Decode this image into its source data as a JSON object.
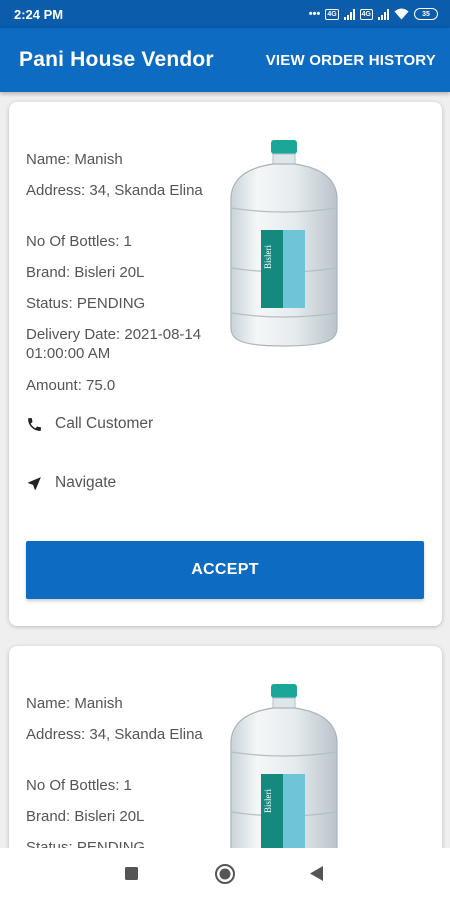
{
  "status_bar": {
    "time": "2:24 PM",
    "battery": "35"
  },
  "app_bar": {
    "title": "Pani House Vendor",
    "history_label": "VIEW ORDER HISTORY"
  },
  "orders": [
    {
      "name": "Name: Manish",
      "address": "Address: 34, Skanda Elina",
      "bottles": "No Of Bottles: 1",
      "brand": "Brand: Bisleri 20L",
      "status": "Status: PENDING",
      "delivery_date": "Delivery Date: 2021-08-14 01:00:00 AM",
      "amount": "Amount: 75.0",
      "call_label": "Call Customer",
      "navigate_label": "Navigate",
      "accept_label": "ACCEPT",
      "bottle_label": "Bisleri"
    },
    {
      "name": "Name: Manish",
      "address": "Address: 34, Skanda Elina",
      "bottles": "No Of Bottles: 1",
      "brand": "Brand: Bisleri 20L",
      "status": "Status: PENDING",
      "bottle_label": "Bisleri"
    }
  ],
  "colors": {
    "primary": "#0d6cc1",
    "status_bar": "#0b5cab",
    "text": "#555555",
    "cap": "#1aa79a"
  },
  "icons": [
    "phone-icon",
    "navigation-arrow-icon",
    "recent-apps-icon",
    "home-icon",
    "back-icon"
  ]
}
